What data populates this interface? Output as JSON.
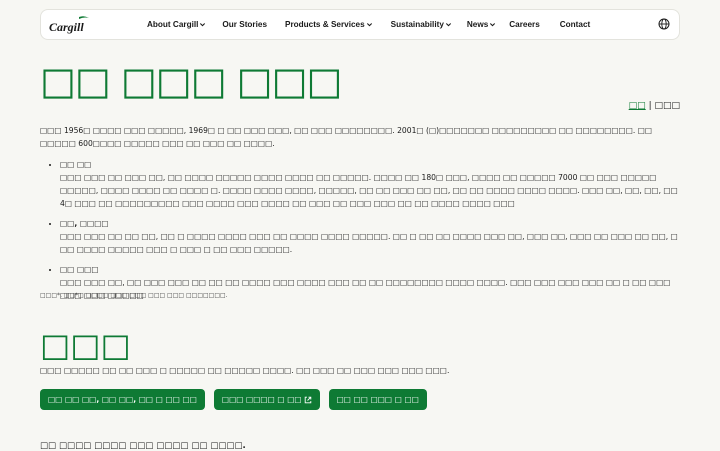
{
  "header": {
    "logo_text": "Cargill",
    "nav": [
      {
        "label": "About Cargill",
        "has_dropdown": true
      },
      {
        "label": "Our Stories",
        "has_dropdown": false
      },
      {
        "label": "Products & Services",
        "has_dropdown": true
      },
      {
        "label": "Sustainability",
        "has_dropdown": true
      },
      {
        "label": "News",
        "has_dropdown": true
      },
      {
        "label": "Careers",
        "has_dropdown": false
      },
      {
        "label": "Contact",
        "has_dropdown": false
      }
    ],
    "globe_icon": "globe-icon"
  },
  "page": {
    "title": "□□ □□□ □□□",
    "language_switch": {
      "active": "□□",
      "separator": "|",
      "other": "□□□"
    },
    "intro": "□□□ 1956□ □□□□ □□□ □□□□□, 1969□ □ □□ □□□ □□□, □□ □□□ □□□□□□□□. 2001□ (□)□□□□□□□ □□□□□□□□□ □□ □□□□□□□□. □□ □□□□□ 600□□□□ □□□□□ □□□ □□ □□□ □□ □□□□.",
    "points": [
      {
        "title": "□□ □□",
        "body": "□□□ □□□ □□ □□□ □□, □□ □□□□ □□□□□ □□□□ □□□□ □□ □□□□□. □□□□ □□ 180□ □□□, □□□□ □□ □□□□□ 7000 □□ □□□ □□□□□ □□□□□, □□□□ □□□□ □□ □□□□ □. □□□□ □□□□ □□□□, □□□□□, □□ □□ □□□ □□ □□, □□ □□ □□□□ □□□□ □□□□. □□□ □□, □□, □□, □□ 4□ □□□ □□ □□□□□□□□□ □□□ □□□□ □□□ □□□□ □□ □□□ □□ □□□ □□□ □□ □□ □□□□ □□□□ □□□"
      },
      {
        "title": "□□, □□□□",
        "body": "□□□ □□□ □□ □□ □□, □□ □ □□□□ □□□□ □□□ □□ □□□□ □□□□ □□□□□. □□ □ □□ □□ □□□□ □□□ □□, □□□ □□, □□□ □□ □□□ □□ □□, □ □□ □□□□ □□□□□ □□□ □ □□□ □ □□ □□□ □□□□□."
      },
      {
        "title": "□□ □□□",
        "body": "□□□ □□□ □□, □□ □□□ □□□ □□ □□ □□ □□□□ □□□ □□□□ □□□ □□ □□ □□□□□□□□ □□□□ □□□□. □□□ □□□ □□□ □□□ □□ □ □□ □□□ □□□ □□□ □□□□□"
      }
    ],
    "footnote": "□□□*, □□*□ □□□□ □□□ □□□ □□□ □□□ □□□□□□□.",
    "section": {
      "title": "□□□",
      "description": "□□□ □□□□□ □□ □□ □□□ □ □□□□□ □□ □□□□□ □□□□. □□ □□□ □□ □□□ □□□ □□□ □□□.",
      "buttons": [
        {
          "label": "□□ □□ □□, □□ □□, □□ □ □□ □□",
          "external": false
        },
        {
          "label": "□□□ □□□□ □ □□",
          "external": true
        },
        {
          "label": "□□ □□ □□□ □ □□",
          "external": false
        }
      ]
    },
    "bottom_text": "□□ □□□□ □□□□ □□□ □□□□ □□ □□□□."
  },
  "colors": {
    "brand_green": "#0e7a34",
    "background": "#f7f7f3"
  }
}
